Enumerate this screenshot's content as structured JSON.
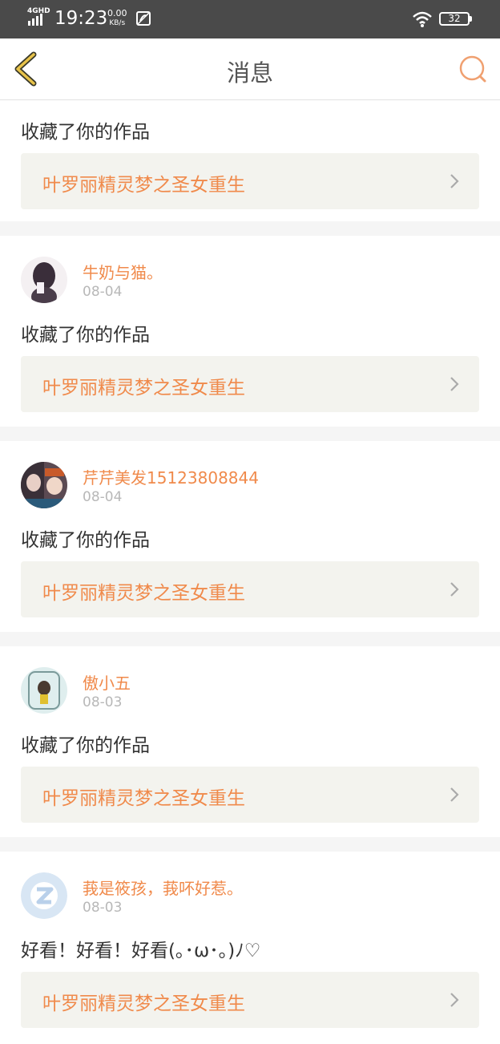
{
  "status_bar": {
    "network": "4GHD",
    "time": "19:23",
    "speed_value": "0.00",
    "speed_unit": "KB/s",
    "battery": "32"
  },
  "nav": {
    "title": "消息",
    "back_icon": "chevron-left-icon",
    "search_icon": "search-icon"
  },
  "colors": {
    "accent": "#f08a4b",
    "back_icon": "#e8c34a",
    "status_bar": "#4a4a4a",
    "work_bg": "#f3f3ee"
  },
  "messages": [
    {
      "action": "收藏了你的作品",
      "work_title": "叶罗丽精灵梦之圣女重生"
    },
    {
      "username": "牛奶与猫。",
      "date": "08-04",
      "action": "收藏了你的作品",
      "work_title": "叶罗丽精灵梦之圣女重生"
    },
    {
      "username": "芹芹美发15123808844",
      "date": "08-04",
      "action": "收藏了你的作品",
      "work_title": "叶罗丽精灵梦之圣女重生"
    },
    {
      "username": "傲小五",
      "date": "08-03",
      "action": "收藏了你的作品",
      "work_title": "叶罗丽精灵梦之圣女重生"
    },
    {
      "username": "莪是筱孩，莪吥好惹。",
      "date": "08-03",
      "action": "好看！好看！好看(｡･ω･｡)ﾉ♡",
      "work_title": "叶罗丽精灵梦之圣女重生"
    }
  ]
}
